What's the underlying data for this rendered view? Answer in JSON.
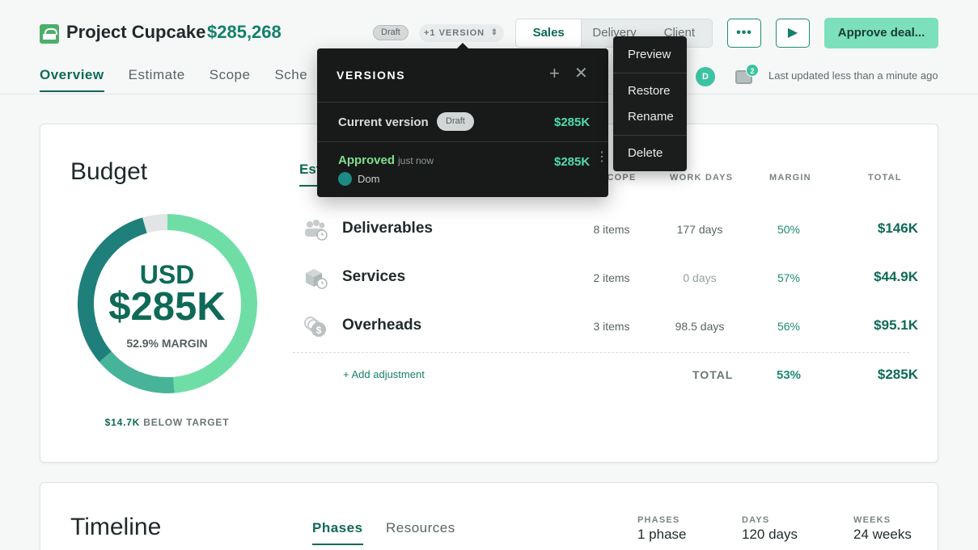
{
  "header": {
    "project_title": "Project Cupcake",
    "project_amount": "$285,268",
    "draft_label": "Draft",
    "version_label": "+1 VERSION",
    "segments": [
      "Sales",
      "Delivery",
      "Client"
    ],
    "more_icon": "•••",
    "play_icon": "▶",
    "approve_label": "Approve deal...",
    "tabs": [
      "Overview",
      "Estimate",
      "Scope",
      "Sche"
    ],
    "avatar_initial": "D",
    "inbox_badge": "2",
    "last_updated": "Last updated less than a minute ago"
  },
  "budget": {
    "title": "Budget",
    "currency": "USD",
    "amount": "$285K",
    "margin_text": "52.9% MARGIN",
    "below_target_amount": "$14.7K",
    "below_target_text": "BELOW TARGET",
    "estimate_tab": "Est",
    "columns": [
      "SCOPE",
      "WORK DAYS",
      "MARGIN",
      "TOTAL"
    ],
    "rows": [
      {
        "name": "Deliverables",
        "scope": "8 items",
        "days": "177 days",
        "margin": "50%",
        "total": "$146K",
        "icon": "people-clock-icon"
      },
      {
        "name": "Services",
        "scope": "2 items",
        "days": "0 days",
        "margin": "57%",
        "total": "$44.9K",
        "icon": "box-clock-icon"
      },
      {
        "name": "Overheads",
        "scope": "3 items",
        "days": "98.5 days",
        "margin": "56%",
        "total": "$95.1K",
        "icon": "coins-dollar-icon"
      }
    ],
    "add_adjustment": "+ Add adjustment",
    "total_label": "TOTAL",
    "total_margin": "53%",
    "total_amount": "$285K",
    "donut_colors": {
      "deliverables": "#6fdea6",
      "services": "#47b398",
      "overheads": "#1f7f7a",
      "remaining": "#e1e5e5"
    }
  },
  "timeline": {
    "title": "Timeline",
    "tabs": [
      "Phases",
      "Resources"
    ],
    "stats": [
      {
        "label": "PHASES",
        "value": "1 phase"
      },
      {
        "label": "DAYS",
        "value": "120 days"
      },
      {
        "label": "WEEKS",
        "value": "24 weeks"
      }
    ]
  },
  "versions_popover": {
    "title": "VERSIONS",
    "plus_icon": "+",
    "close_icon": "✕",
    "current_label": "Current version",
    "current_badge": "Draft",
    "current_amount": "$285K",
    "approved_label": "Approved",
    "approved_when": "just now",
    "approved_user": "Dom",
    "approved_amount": "$285K",
    "kebab_icon": "⋮"
  },
  "context_menu": {
    "items": [
      "Preview",
      "Restore",
      "Rename",
      "Delete"
    ]
  }
}
